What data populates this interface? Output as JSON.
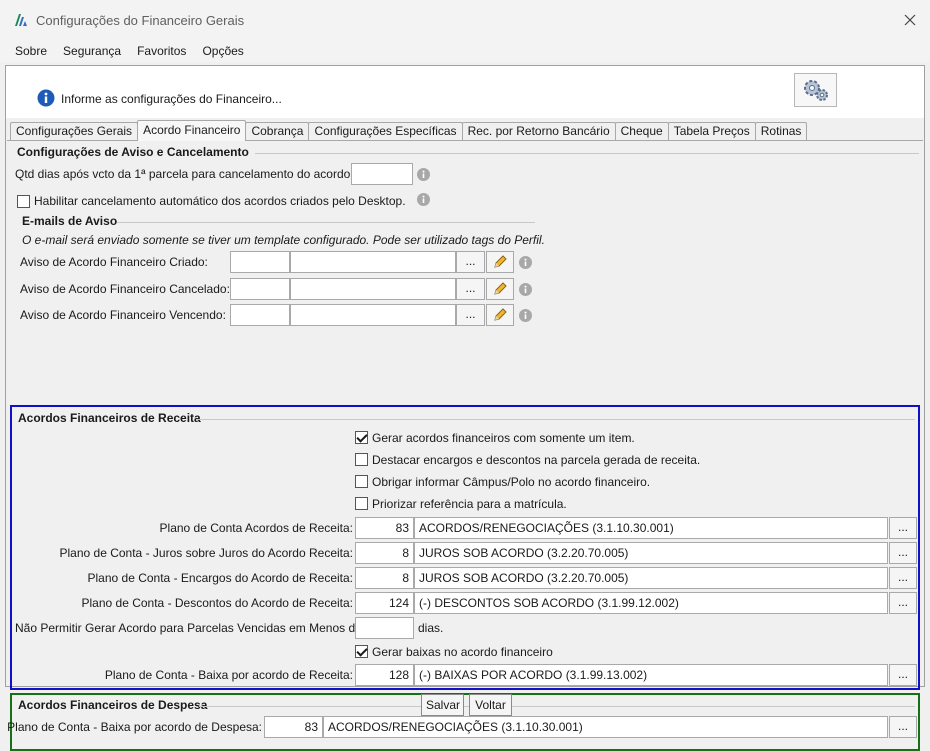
{
  "window": {
    "title": "Configurações do Financeiro Gerais"
  },
  "menu": {
    "items": [
      "Sobre",
      "Segurança",
      "Favoritos",
      "Opções"
    ]
  },
  "header": {
    "info_text": "Informe as configurações do Financeiro..."
  },
  "tabs": [
    {
      "label": "Configurações Gerais"
    },
    {
      "label": "Acordo Financeiro"
    },
    {
      "label": "Cobrança"
    },
    {
      "label": "Configurações Específicas"
    },
    {
      "label": "Rec. por Retorno Bancário"
    },
    {
      "label": "Cheque"
    },
    {
      "label": "Tabela Preços"
    },
    {
      "label": "Rotinas"
    }
  ],
  "aviso": {
    "title": "Configurações de Aviso e Cancelamento",
    "qtd_dias_label": "Qtd dias após vcto da 1ª parcela para cancelamento do acordo:",
    "qtd_dias_value": "",
    "habilitar_label": "Habilitar cancelamento automático dos acordos criados pelo Desktop.",
    "habilitar_checked": false,
    "emails_title": "E-mails de Aviso",
    "emails_note": "O e-mail será enviado somente se tiver um template configurado. Pode ser utilizado tags do Perfil.",
    "email_rows": [
      {
        "label": "Aviso de Acordo Financeiro Criado:",
        "code": "",
        "desc": ""
      },
      {
        "label": "Aviso de Acordo Financeiro Cancelado:",
        "code": "",
        "desc": ""
      },
      {
        "label": "Aviso de Acordo Financeiro Vencendo:",
        "code": "",
        "desc": ""
      }
    ],
    "browse_label": "..."
  },
  "receita": {
    "title": "Acordos Financeiros de Receita",
    "checks": [
      {
        "label": "Gerar acordos financeiros com somente um item.",
        "checked": true
      },
      {
        "label": "Destacar encargos e descontos na parcela gerada de receita.",
        "checked": false
      },
      {
        "label": "Obrigar informar Câmpus/Polo no acordo financeiro.",
        "checked": false
      },
      {
        "label": "Priorizar referência para a matrícula.",
        "checked": false
      }
    ],
    "planos": [
      {
        "label": "Plano de Conta Acordos de Receita:",
        "code": "83",
        "desc": "ACORDOS/RENEGOCIAÇÕES (3.1.10.30.001)"
      },
      {
        "label": "Plano de Conta - Juros sobre Juros do Acordo Receita:",
        "code": "8",
        "desc": "JUROS SOB ACORDO (3.2.20.70.005)"
      },
      {
        "label": "Plano de Conta - Encargos do Acordo de Receita:",
        "code": "8",
        "desc": "JUROS SOB ACORDO (3.2.20.70.005)"
      },
      {
        "label": "Plano de Conta - Descontos do Acordo de Receita:",
        "code": "124",
        "desc": "(-) DESCONTOS SOB ACORDO (3.1.99.12.002)"
      }
    ],
    "nao_permitir_label": "Não Permitir Gerar Acordo para Parcelas Vencidas em Menos de",
    "nao_permitir_value": "",
    "dias_label": "dias.",
    "gerar_baixas_label": "Gerar baixas no acordo financeiro",
    "gerar_baixas_checked": true,
    "baixa": {
      "label": "Plano de Conta - Baixa por acordo de Receita:",
      "code": "128",
      "desc": "(-) BAIXAS POR ACORDO (3.1.99.13.002)"
    },
    "browse_label": "..."
  },
  "despesa": {
    "title": "Acordos Financeiros de Despesa",
    "baixa": {
      "label": "Plano de Conta - Baixa por acordo de Despesa:",
      "code": "83",
      "desc": "ACORDOS/RENEGOCIAÇÕES (3.1.10.30.001)"
    },
    "browse_label": "..."
  },
  "footer": {
    "save_label": "Salvar",
    "back_label": "Voltar"
  },
  "colors": {
    "receita_border": "#1010c8",
    "despesa_border": "#167016",
    "info_blue": "#1e5bb8"
  }
}
